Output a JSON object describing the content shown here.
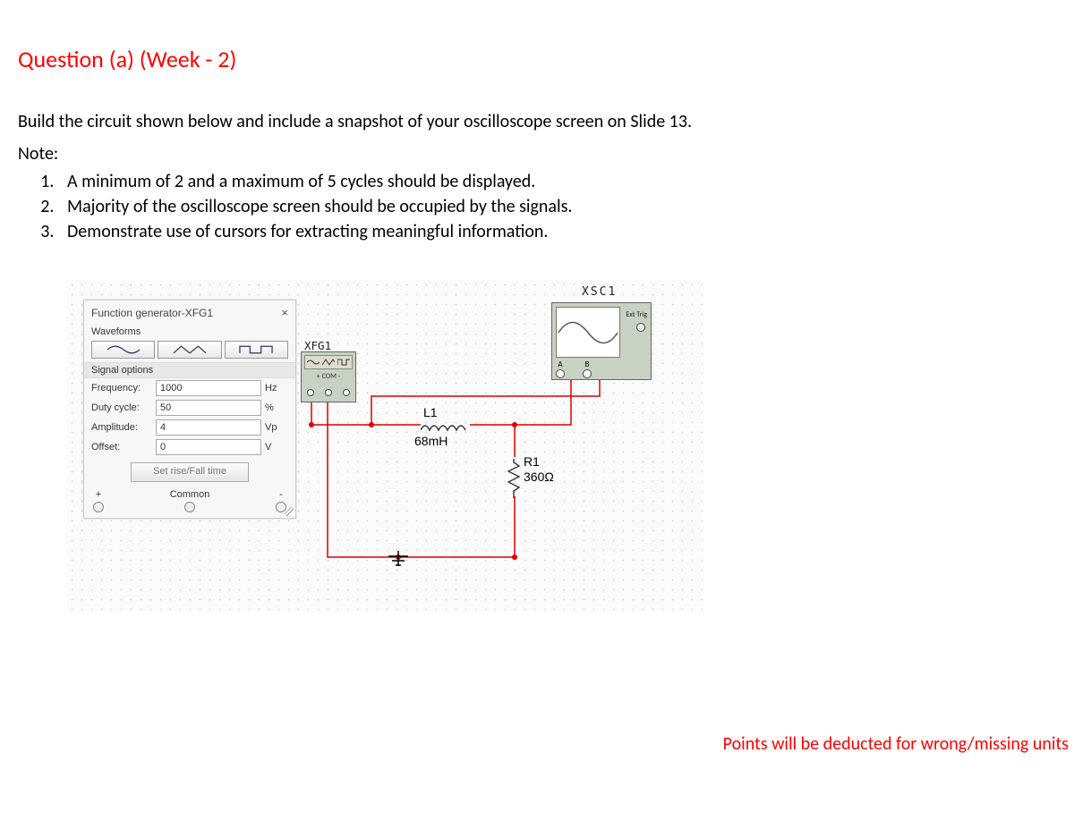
{
  "title": "Question (a) (Week  - 2)",
  "instruction": "Build the circuit shown below and include a snapshot of your oscilloscope screen on Slide 13.",
  "note_label": "Note:",
  "notes": [
    "A minimum of 2 and a maximum of 5 cycles should be displayed.",
    "Majority of the oscilloscope screen should be occupied by the signals.",
    "Demonstrate use of cursors for extracting meaningful information."
  ],
  "function_generator": {
    "title": "Function generator-XFG1",
    "waveforms_label": "Waveforms",
    "signal_options_label": "Signal options",
    "frequency": {
      "label": "Frequency:",
      "value": "1000",
      "unit": "Hz"
    },
    "duty_cycle": {
      "label": "Duty cycle:",
      "value": "50",
      "unit": "%"
    },
    "amplitude": {
      "label": "Amplitude:",
      "value": "4",
      "unit": "Vp"
    },
    "offset": {
      "label": "Offset:",
      "value": "0",
      "unit": "V"
    },
    "set_button": "Set rise/Fall time",
    "terminals": {
      "plus": "+",
      "common": "Common",
      "minus": "-"
    }
  },
  "xfg_instrument": {
    "name": "XFG1",
    "row2": "+  COM  -"
  },
  "oscilloscope": {
    "name": "XSC1",
    "ext_trig": "Ext Trig",
    "ch_a": "A",
    "ch_b": "B"
  },
  "components": {
    "L1": {
      "name": "L1",
      "value": "68mH"
    },
    "R1": {
      "name": "R1",
      "value": "360Ω"
    }
  },
  "footer": "Points will be deducted for wrong/missing units"
}
